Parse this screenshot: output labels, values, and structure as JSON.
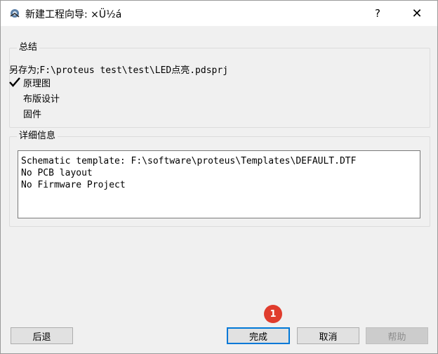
{
  "window": {
    "title": "新建工程向导: ×Ü½á",
    "help_glyph": "?",
    "close_glyph": "✕"
  },
  "summary": {
    "legend": "总结",
    "save_label": "另存为;",
    "save_path": "F:\\proteus test\\test\\LED点亮.pdsprj",
    "items": [
      {
        "label": "原理图",
        "checked": true
      },
      {
        "label": "布版设计",
        "checked": false
      },
      {
        "label": "固件",
        "checked": false
      }
    ]
  },
  "details": {
    "legend": "详细信息",
    "lines": [
      "Schematic template: F:\\software\\proteus\\Templates\\DEFAULT.DTF",
      "No PCB layout",
      "No Firmware Project"
    ]
  },
  "buttons": {
    "back": "后退",
    "finish": "完成",
    "cancel": "取消",
    "help": "帮助"
  },
  "annotation": {
    "badge": "1",
    "badge_color": "#e03c2d"
  }
}
